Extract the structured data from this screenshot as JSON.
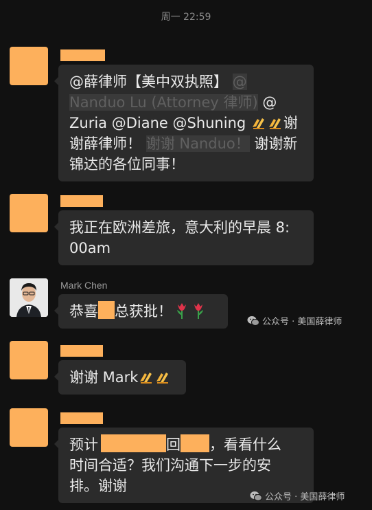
{
  "timestamp": "周一 22:59",
  "messages": [
    {
      "lines": [
        [
          "@薛律师【美中双执照】",
          "@"
        ],
        [
          "Nanduo Lu (Attorney 律师)",
          "@"
        ],
        [
          "Zuria @Diane @Shuning "
        ],
        [
          "谢薛律师！",
          "谢谢 Nanduo！",
          " 谢谢新"
        ],
        [
          "锦达的各位同事！"
        ]
      ],
      "l1": "@薛律师【美中双执照】",
      "l1_hl": "@",
      "l2_hl": "Nanduo Lu (Attorney 律师)",
      "l2_tail": " @",
      "l3": "Zuria @Diane @Shuning ",
      "l3_tail": "谢",
      "l4a": "谢薛律师！",
      "l4_hl": "谢谢 Nanduo！",
      "l4b": " 谢谢新",
      "l5": "锦达的各位同事！"
    },
    {
      "l1": "我正在欧洲差旅，意大利的早晨 8:",
      "l2": "00am"
    },
    {
      "sender": "Mark Chen",
      "l1a": "恭喜",
      "l1b": "总获批！"
    },
    {
      "l1": "谢谢 Mark"
    },
    {
      "l1a": "预计",
      "l1b": "回",
      "l1c": "，看看什么",
      "l2": "时间合适？我们沟通下一步的安",
      "l3": "排。谢谢"
    }
  ],
  "watermark_text": "公众号 · 美国薛律师",
  "colors": {
    "background": "#111111",
    "bubble": "#2b2b2b",
    "redaction": "#fdb05c",
    "text": "#e9e9e9",
    "meta": "#8a8a8a"
  },
  "icons": [
    "clap-icon",
    "tulip-icon",
    "wechat-icon"
  ]
}
